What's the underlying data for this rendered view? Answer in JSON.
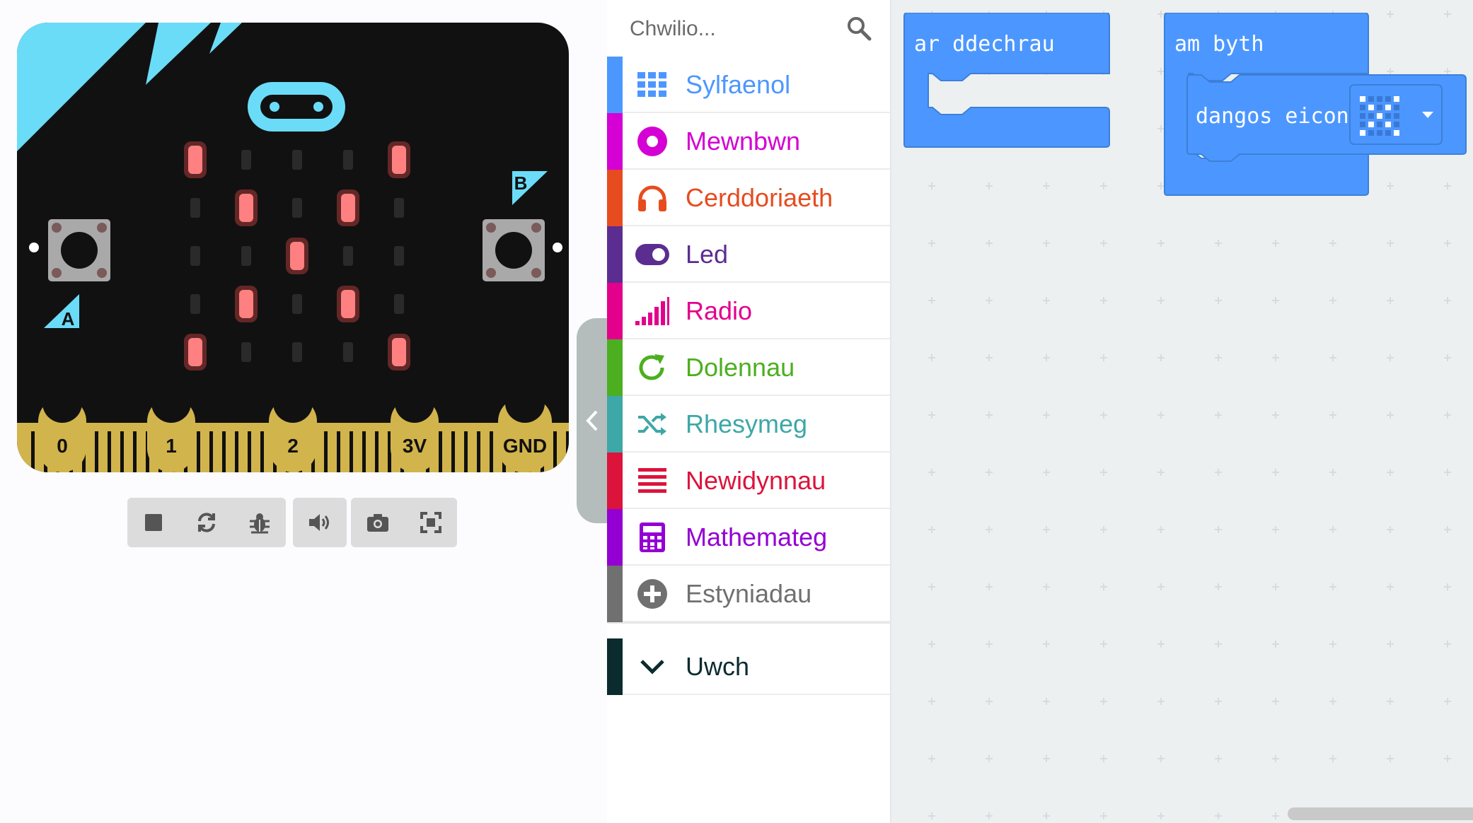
{
  "simulator": {
    "board": {
      "buttons": {
        "a": "A",
        "b": "B"
      },
      "pins": [
        "0",
        "1",
        "2",
        "3V",
        "GND"
      ],
      "led_matrix": [
        [
          1,
          0,
          0,
          0,
          1
        ],
        [
          0,
          1,
          0,
          1,
          0
        ],
        [
          0,
          0,
          1,
          0,
          0
        ],
        [
          0,
          1,
          0,
          1,
          0
        ],
        [
          1,
          0,
          0,
          0,
          1
        ]
      ]
    },
    "toolbar": {
      "buttons": [
        "stop-icon",
        "restart-icon",
        "debug-icon",
        "sound-icon",
        "screenshot-icon",
        "fullscreen-icon"
      ]
    }
  },
  "toolbox": {
    "search": {
      "placeholder": "Chwilio..."
    },
    "categories": [
      {
        "label": "Sylfaenol",
        "color": "#4c97ff",
        "icon": "grid-icon"
      },
      {
        "label": "Mewnbwn",
        "color": "#d400d4",
        "icon": "circle-dot-icon"
      },
      {
        "label": "Cerddoriaeth",
        "color": "#e64c1f",
        "icon": "headphones-icon"
      },
      {
        "label": "Led",
        "color": "#5c2d91",
        "icon": "toggle-icon"
      },
      {
        "label": "Radio",
        "color": "#e3008c",
        "icon": "signal-bars-icon"
      },
      {
        "label": "Dolennau",
        "color": "#4caf20",
        "icon": "refresh-icon"
      },
      {
        "label": "Rhesymeg",
        "color": "#3ea7a7",
        "icon": "shuffle-icon"
      },
      {
        "label": "Newidynnau",
        "color": "#dc143c",
        "icon": "list-icon"
      },
      {
        "label": "Mathemateg",
        "color": "#9400d3",
        "icon": "calculator-icon"
      },
      {
        "label": "Estyniadau",
        "color": "#707070",
        "icon": "plus-circle-icon"
      }
    ],
    "advanced": {
      "label": "Uwch",
      "color": "#0b2b2f",
      "icon": "chevron-down-icon"
    }
  },
  "workspace": {
    "blocks": {
      "on_start": {
        "label": "ar ddechrau"
      },
      "forever": {
        "label": "am byth"
      },
      "show_icon": {
        "label": "dangos eicon",
        "icon_matrix": [
          [
            1,
            0,
            0,
            0,
            1
          ],
          [
            0,
            1,
            0,
            1,
            0
          ],
          [
            0,
            0,
            1,
            0,
            0
          ],
          [
            0,
            1,
            0,
            1,
            0
          ],
          [
            1,
            0,
            0,
            0,
            1
          ]
        ]
      }
    }
  }
}
